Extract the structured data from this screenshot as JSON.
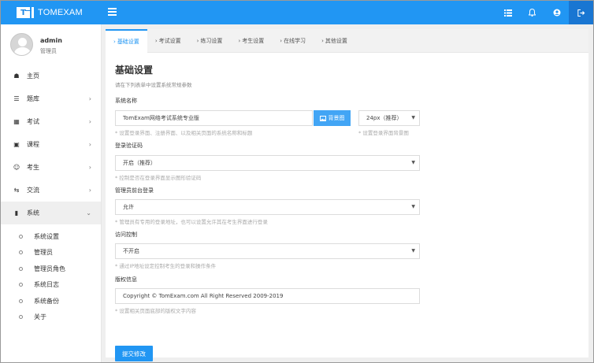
{
  "brand": {
    "logo_text": "T",
    "name": "TOMEXAM"
  },
  "topbar": {
    "icons": [
      "list-icon",
      "bell-icon",
      "user-circle-icon",
      "logout-icon"
    ]
  },
  "user": {
    "name": "admin",
    "role": "管理员"
  },
  "sidebar": {
    "items": [
      {
        "label": "主页",
        "icon": "home-icon"
      },
      {
        "label": "题库",
        "icon": "database-icon"
      },
      {
        "label": "考试",
        "icon": "calendar-icon"
      },
      {
        "label": "课程",
        "icon": "book-icon"
      },
      {
        "label": "考生",
        "icon": "user-icon"
      },
      {
        "label": "交流",
        "icon": "shuffle-icon"
      },
      {
        "label": "系统",
        "icon": "mobile-icon"
      }
    ],
    "subitems": [
      "系统设置",
      "管理员",
      "管理员角色",
      "系统日志",
      "系统备份",
      "关于"
    ]
  },
  "tabs": [
    "基础设置",
    "考试设置",
    "练习设置",
    "考生设置",
    "在线学习",
    "其他设置"
  ],
  "page": {
    "title": "基础设置",
    "subtitle": "请在下列表单中设置系统常规参数"
  },
  "form": {
    "system_name": {
      "label": "系统名称",
      "value": "TomExam网络考试系统专业版",
      "bg_button": "背景图",
      "size_value": "24px（推荐）",
      "help": "* 设置登录界面、注册界面、以及相关页面的系统名称和标题",
      "size_help": "* 设置登录界面背景图"
    },
    "login_captcha": {
      "label": "登录验证码",
      "value": "开启（推荐）",
      "help": "* 控制是否在登录界面显示图形验证码"
    },
    "admin_login": {
      "label": "管理员前台登录",
      "value": "允许",
      "help": "* 管理员有专用的登录地址，也可以设置允许其在考生界面进行登录"
    },
    "access_control": {
      "label": "访问控制",
      "value": "不开启",
      "help": "* 通过IP地址设定控制考生的登录和操作条件"
    },
    "copyright": {
      "label": "版权信息",
      "value": "Copyright  © TomExam.com  All Right Reserved 2009-2019",
      "help": "* 设置相关页面底部的版权文字内容"
    }
  },
  "submit_label": "提交修改"
}
